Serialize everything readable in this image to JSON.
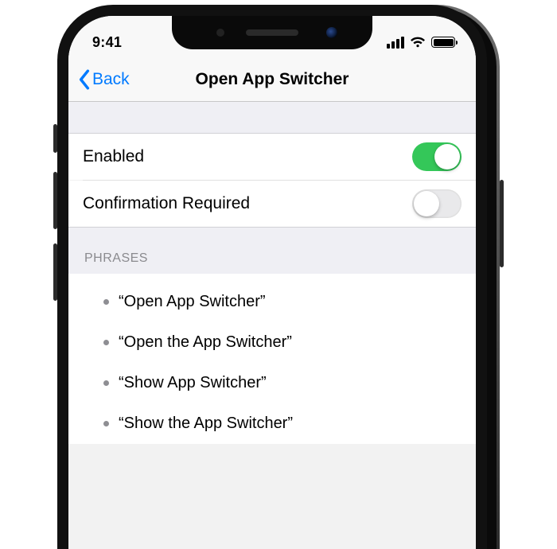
{
  "status": {
    "time": "9:41"
  },
  "nav": {
    "back_label": "Back",
    "title": "Open App Switcher"
  },
  "toggles": {
    "enabled": {
      "label": "Enabled",
      "value": true
    },
    "confirmation": {
      "label": "Confirmation Required",
      "value": false
    }
  },
  "phrases": {
    "header": "PHRASES",
    "items": [
      "Open App Switcher",
      "Open the App Switcher",
      "Show App Switcher",
      "Show the App Switcher"
    ]
  }
}
